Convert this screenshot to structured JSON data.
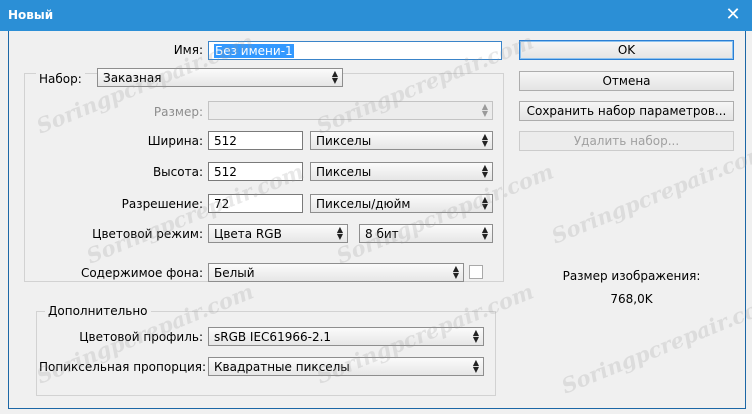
{
  "window": {
    "title": "Новый"
  },
  "form": {
    "name_label": "Имя:",
    "name_value": "Без имени-1",
    "preset_label": "Набор:",
    "preset_value": "Заказная",
    "size_label": "Размер:",
    "size_value": "",
    "width_label": "Ширина:",
    "width_value": "512",
    "width_unit": "Пикселы",
    "height_label": "Высота:",
    "height_value": "512",
    "height_unit": "Пикселы",
    "resolution_label": "Разрешение:",
    "resolution_value": "72",
    "resolution_unit": "Пикселы/дюйм",
    "color_mode_label": "Цветовой режим:",
    "color_mode_value": "Цвета RGB",
    "bit_depth_value": "8 бит",
    "background_label": "Содержимое фона:",
    "background_value": "Белый"
  },
  "advanced": {
    "title": "Дополнительно",
    "color_profile_label": "Цветовой профиль:",
    "color_profile_value": "sRGB IEC61966-2.1",
    "pixel_aspect_label": "Попиксельная пропорция:",
    "pixel_aspect_value": "Квадратные пикселы"
  },
  "buttons": {
    "ok": "OK",
    "cancel": "Отмена",
    "save_preset": "Сохранить набор параметров...",
    "delete_preset": "Удалить набор..."
  },
  "image_size": {
    "label": "Размер изображения:",
    "value": "768,0K"
  },
  "watermark": {
    "text": "Soringpcrepair.com"
  }
}
